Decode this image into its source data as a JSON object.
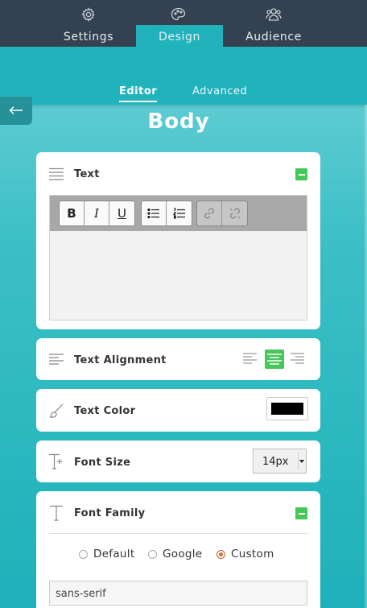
{
  "tabs": {
    "settings": "Settings",
    "design": "Design",
    "audience": "Audience"
  },
  "subtabs": {
    "editor": "Editor",
    "advanced": "Advanced"
  },
  "page_title": "Body",
  "text_card": {
    "title": "Text"
  },
  "alignment_card": {
    "title": "Text Alignment",
    "selected": "center"
  },
  "color_card": {
    "title": "Text Color",
    "value": "#000000"
  },
  "font_size_card": {
    "title": "Font Size",
    "value": "14px"
  },
  "font_family_card": {
    "title": "Font Family",
    "options": {
      "default": "Default",
      "google": "Google",
      "custom": "Custom"
    },
    "selected": "custom",
    "custom_value": "sans-serif"
  },
  "colors": {
    "accent": "#21b3bc",
    "dark": "#334150",
    "green": "#46c759",
    "radio": "#e2692f"
  }
}
